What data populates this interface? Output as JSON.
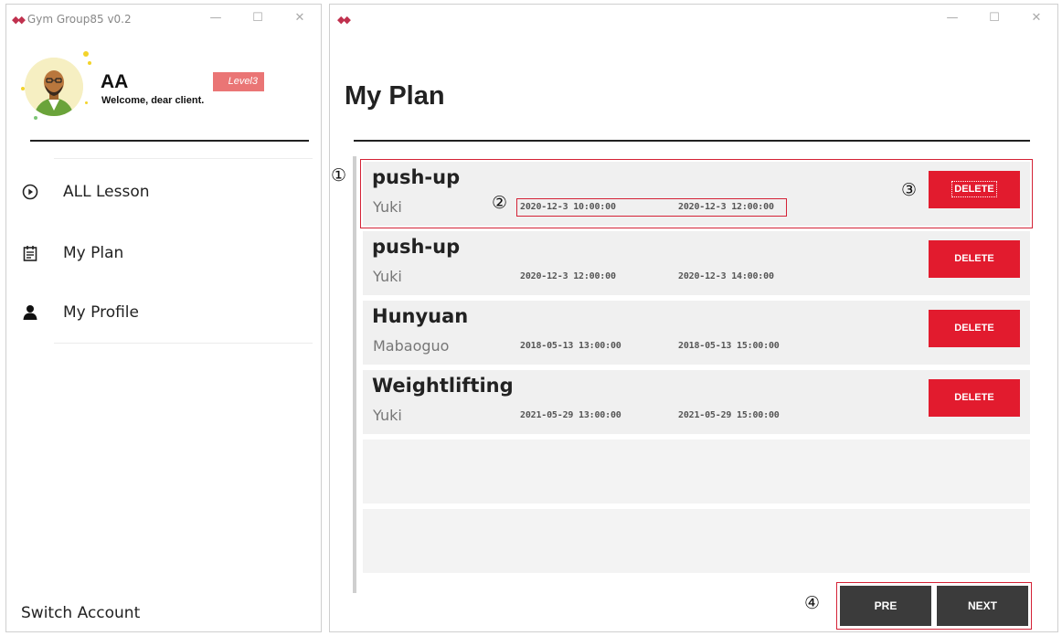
{
  "left_window": {
    "title": "Gym Group85 v0.2",
    "controls": {
      "minimize": "—",
      "maximize": "☐",
      "close": "✕"
    },
    "user": {
      "name": "AA",
      "welcome": "Welcome, dear client.",
      "level": "Level3"
    },
    "nav": [
      {
        "label": "ALL Lesson",
        "icon": "play-circle-icon"
      },
      {
        "label": "My Plan",
        "icon": "calendar-list-icon"
      },
      {
        "label": "My Profile",
        "icon": "user-icon"
      }
    ],
    "switch_account": "Switch Account"
  },
  "right_window": {
    "controls": {
      "minimize": "—",
      "maximize": "☐",
      "close": "✕"
    },
    "page_title": "My Plan",
    "plans": [
      {
        "lesson": "push-up",
        "coach": "Yuki",
        "start": "2020-12-3 10:00:00",
        "end": "2020-12-3 12:00:00",
        "action": "DELETE"
      },
      {
        "lesson": "push-up",
        "coach": "Yuki",
        "start": "2020-12-3 12:00:00",
        "end": "2020-12-3 14:00:00",
        "action": "DELETE"
      },
      {
        "lesson": "Hunyuan",
        "coach": "Mabaoguo",
        "start": "2018-05-13 13:00:00",
        "end": "2018-05-13 15:00:00",
        "action": "DELETE"
      },
      {
        "lesson": "Weightlifting",
        "coach": "Yuki",
        "start": "2021-05-29 13:00:00",
        "end": "2021-05-29 15:00:00",
        "action": "DELETE"
      }
    ],
    "pager": {
      "prev": "PRE",
      "next": "NEXT"
    }
  },
  "callouts": [
    "①",
    "②",
    "③",
    "④"
  ],
  "colors": {
    "accent_red": "#e21b2e",
    "annotation_red": "#d42236",
    "level_badge": "#ea7575",
    "pager_dark": "#3b3b3b",
    "row_bg": "#f0f0f0"
  }
}
